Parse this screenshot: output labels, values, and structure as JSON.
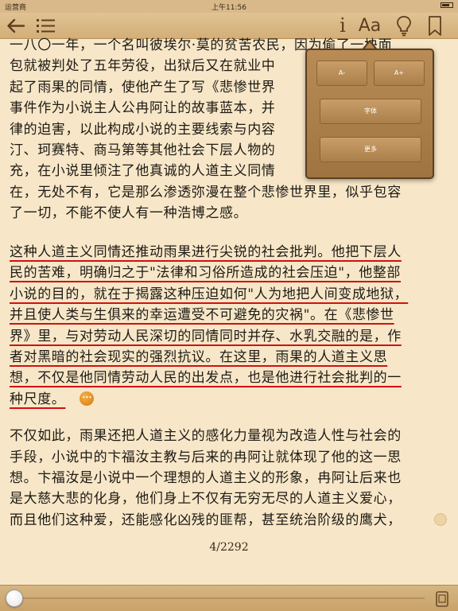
{
  "status_bar": {
    "carrier": "运营商 ",
    "time": "上午11:56",
    "battery": "■"
  },
  "toolbar": {
    "back_icon": "back-arrow-icon",
    "toc_icon": "list-icon",
    "info_label": "i",
    "font_label": "Aa",
    "bulb_icon": "lightbulb-icon",
    "bookmark_icon": "bookmark-icon"
  },
  "content": {
    "paragraph_1_lines": [
      "一八〇一年，一个名叫彼埃尔·莫的贫苦农民，因为偷了一块面",
      "包就被判处了五年劳役，出狱后又在就业中",
      "起了雨果的同情，使他产生了写《悲惨世界",
      "事件作为小说主人公冉阿让的故事蓝本，并",
      "律的迫害，以此构成小说的主要线索与内容",
      "汀、珂赛特、商马第等其他社会下层人物的",
      "充，在小说里倾注了他真诚的人道主义同情",
      "在，无处不有，它是那么渗透弥漫在整个悲惨世界里，似乎包容",
      "了一切，不能不使人有一种浩博之感。"
    ],
    "paragraph_2_lines": [
      "这种人道主义同情还推动雨果进行尖锐的社会批判。他把下层人",
      "民的苦难，明确归之于\"法律和习俗所造成的社会压迫\"，他整部",
      "小说的目的，就在于揭露这种压迫如何\"人为地把人间变成地狱，",
      "并且使人类与生俱来的幸运遭受不可避免的灾祸\"。在《悲惨世",
      "界》里，与对劳动人民深切的同情同时并存、水乳交融的是，作",
      "者对黑暗的社会现实的强烈抗议。在这里，雨果的人道主义思",
      "想，不仅是他同情劳动人民的出发点，也是他进行社会批判的一",
      "种尺度。"
    ],
    "paragraph_3_lines": [
      "不仅如此，雨果还把人道主义的感化力量视为改造人性与社会的",
      "手段，小说中的卞福汝主教与后来的冉阿让就体现了他的这一思",
      "想。卞福汝是小说中一个理想的人道主义的形象，冉阿让后来也",
      "是大慈大悲的化身，他们身上不仅有无穷无尽的人道主义爱心，",
      "而且他们这种爱，还能感化凶残的匪帮，甚至统治阶级的鹰犬，"
    ],
    "note_icon": "note-bubble-icon",
    "highlight_color": "#d21010"
  },
  "popover": {
    "smaller_label": "A-",
    "larger_label": "A+",
    "font_label": "字体",
    "more_label": "更多"
  },
  "page_indicator": "4/2292",
  "progress": {
    "current_page": 4,
    "total_pages": 2292,
    "fraction": 0.0017
  },
  "bottom_bar": {
    "scroll_icon": "scroll-knob-icon",
    "view_icon": "page-view-icon"
  },
  "colors": {
    "page_background": "#f7e7c8",
    "toolbar": "#d9b98a",
    "popover": "#b98c55",
    "note_badge": "#e8901c"
  }
}
